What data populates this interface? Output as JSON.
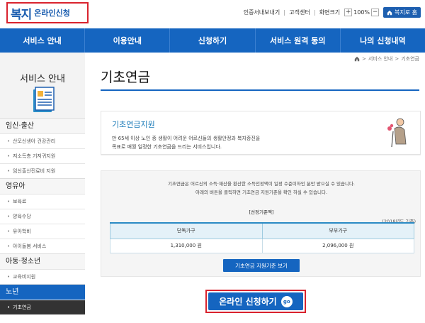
{
  "header": {
    "logo_main": "복지",
    "logo_sub": "온라인신청",
    "utility_links": [
      "인증서내보내기",
      "고객센터"
    ],
    "zoom_label": "화면크기",
    "zoom_in": "+",
    "zoom_value": "100%",
    "zoom_out": "−",
    "home_button": "복지로 홈"
  },
  "nav": {
    "items": [
      "서비스 안내",
      "이용안내",
      "신청하기",
      "서비스 원격 동의",
      "나의 신청내역"
    ]
  },
  "breadcrumb": [
    "서비스 안내",
    "기초연금"
  ],
  "sidebar": {
    "title": "서비스 안내",
    "groups": [
      {
        "label": "임신·출산",
        "items": [
          "산모신생아 건강관리",
          "저소득층 기저귀지원",
          "임신출산진료비 지원"
        ]
      },
      {
        "label": "영유아",
        "items": [
          "보육료",
          "양육수당",
          "유아학비",
          "아이돌봄 서비스"
        ]
      },
      {
        "label": "아동·청소년",
        "items": [
          "교육비지원"
        ]
      },
      {
        "label": "노년",
        "items": [
          "기초연금"
        ]
      }
    ]
  },
  "main": {
    "page_title": "기초연금",
    "info": {
      "title": "기초연금지원",
      "line1": "만 65세 이상 노인 중 생활이 어려운 어르신들의 생활안정과 복지증진을",
      "line2": "목표로 매월 일정한 기초연금을 드리는 서비스입니다."
    },
    "criteria": {
      "line1": "기초연금은 어르신의 소득·재산을 환산한 소득인정액이 일정 수준이하인 분만 받으실 수 있습니다.",
      "line2": "아래의 버튼을 클릭하면 기초연금 지원기준을 확인 하실 수 있습니다.",
      "caption": "[선정기준액]",
      "year_note": "(2018년도 기준)",
      "headers": [
        "단독가구",
        "부부가구"
      ],
      "values": [
        "1,310,000 원",
        "2,096,000 원"
      ],
      "button": "기초연금 지원기준 보기"
    },
    "apply_button": "온라인 신청하기",
    "apply_badge": "go"
  },
  "colors": {
    "primary": "#1565c0",
    "highlight": "#d9232e"
  }
}
